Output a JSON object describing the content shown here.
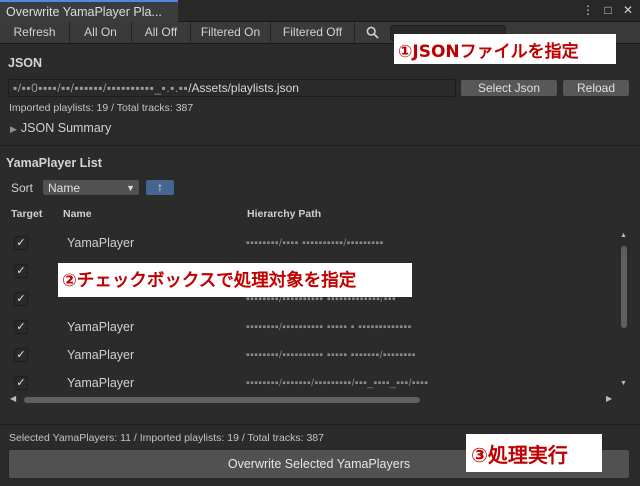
{
  "window": {
    "tab_title": "Overwrite YamaPlayer Pla...",
    "controls": [
      "⋮",
      "□",
      "✕"
    ]
  },
  "toolbar": {
    "refresh": "Refresh",
    "all_on": "All On",
    "all_off": "All Off",
    "filtered_on": "Filtered On",
    "filtered_off": "Filtered Off",
    "search_icon": "search-icon"
  },
  "json_section": {
    "title": "JSON",
    "path_prefix": "▪/▪▪0▪▪▪▪/▪▪/▪▪▪▪▪▪/▪▪▪▪▪▪▪▪▪▪_▪.▪.▪▪",
    "path_suffix": "/Assets/playlists.json",
    "select_json": "Select Json",
    "reload": "Reload",
    "imported_summary": "Imported playlists: 19 / Total tracks: 387",
    "summary_foldout": "JSON Summary"
  },
  "list_section": {
    "title": "YamaPlayer List",
    "sort_label": "Sort",
    "sort_value": "Name",
    "sort_direction": "↑",
    "columns": {
      "target": "Target",
      "name": "Name",
      "path": "Hierarchy Path"
    },
    "rows": [
      {
        "checked": "✓",
        "name": "YamaPlayer",
        "path": "▪▪▪▪▪▪▪▪/▪▪▪▪ ▪▪▪▪▪▪▪▪▪▪/▪▪▪▪▪▪▪▪▪"
      },
      {
        "checked": "✓",
        "name": "",
        "path": "▪▪▪▪▪▪▪▪▪▪/▪▪▪▪_▪▪▪▪▪▪/▪▪▪▪▪▪▪▪▪▪▪▪▪"
      },
      {
        "checked": "✓",
        "name": "",
        "path": "▪▪▪▪▪▪▪▪/▪▪▪▪▪▪▪▪▪▪ ▪▪▪▪▪▪▪▪▪▪▪▪▪/▪▪▪"
      },
      {
        "checked": "✓",
        "name": "YamaPlayer",
        "path": "▪▪▪▪▪▪▪▪/▪▪▪▪▪▪▪▪▪▪ ▪▪▪▪▪ ▪ ▪▪▪▪▪▪▪▪▪▪▪▪▪"
      },
      {
        "checked": "✓",
        "name": "YamaPlayer",
        "path": "▪▪▪▪▪▪▪▪/▪▪▪▪▪▪▪▪▪▪ ▪▪▪▪▪ ▪▪▪▪▪▪▪/▪▪▪▪▪▪▪▪"
      },
      {
        "checked": "✓",
        "name": "YamaPlayer",
        "path": "▪▪▪▪▪▪▪▪/▪▪▪▪▪▪▪/▪▪▪▪▪▪▪▪▪/▪▪▪_▪▪▪▪_▪▪▪/▪▪▪▪"
      }
    ]
  },
  "footer": {
    "status": "Selected YamaPlayers: 11 / Imported playlists: 19 / Total tracks: 387",
    "overwrite_button": "Overwrite Selected YamaPlayers"
  },
  "annotations": {
    "step1": "①JSONファイルを指定",
    "step2": "②チェックボックスで処理対象を指定",
    "step3": "③処理実行"
  },
  "colors": {
    "annotation_text": "#c00000",
    "annotation_bg": "#ffffff",
    "sort_direction_bg": "#45668f",
    "tab_accent": "#4a8be0"
  }
}
